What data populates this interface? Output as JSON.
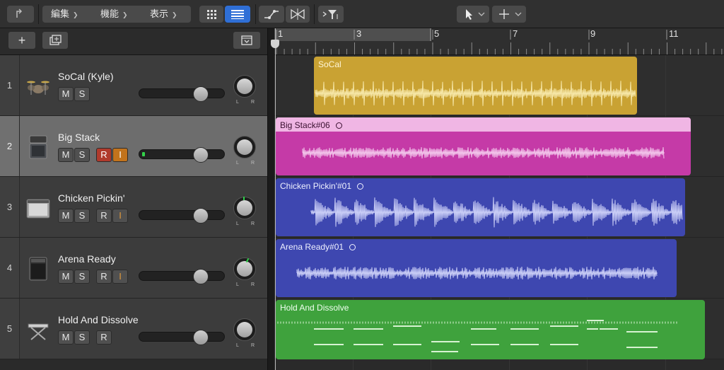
{
  "toolbar": {
    "back_icon": "catch-back-icon",
    "menus": [
      {
        "label": "編集"
      },
      {
        "label": "機能"
      },
      {
        "label": "表示"
      }
    ],
    "grid_view_icon": "grid-view-icon",
    "list_view_icon": "list-view-icon",
    "automation_icon": "automation-curve-icon",
    "flex_icon": "flex-time-icon",
    "catch_icon": "snap-filter-icon",
    "pointer_tool_icon": "pointer-tool-icon",
    "secondary_tool_icon": "crosshair-tool-icon",
    "accent": "#2f6fd6"
  },
  "header": {
    "add_track_icon": "plus-icon",
    "duplicate_track_icon": "duplicate-track-icon",
    "global_tracks_icon": "global-tracks-icon"
  },
  "ruler": {
    "bars": [
      "1",
      "3",
      "5",
      "7",
      "9",
      "11"
    ]
  },
  "tracks": [
    {
      "number": "1",
      "name": "SoCal (Kyle)",
      "icon": "drum-kit-icon",
      "mute": "M",
      "solo": "S",
      "record": "",
      "input": ""
    },
    {
      "number": "2",
      "name": "Big Stack",
      "icon": "amp-stack-icon",
      "mute": "M",
      "solo": "S",
      "record": "R",
      "input": "I"
    },
    {
      "number": "3",
      "name": "Chicken Pickin'",
      "icon": "combo-amp-icon",
      "mute": "M",
      "solo": "S",
      "record": "R",
      "input": "I"
    },
    {
      "number": "4",
      "name": "Arena Ready",
      "icon": "amp-head-icon",
      "mute": "M",
      "solo": "S",
      "record": "R",
      "input": "I"
    },
    {
      "number": "5",
      "name": "Hold And Dissolve",
      "icon": "keyboard-stand-icon",
      "mute": "M",
      "solo": "S",
      "record": "R",
      "input": ""
    }
  ],
  "pan_labels": {
    "left": "L",
    "right": "R"
  },
  "regions": [
    {
      "name": "SoCal",
      "color": "#c9a233",
      "wave": "#f6e7a8"
    },
    {
      "name": "Big Stack#06",
      "color": "#c53aa7",
      "header": "#f0b6e4",
      "wave": "#f2c4ea"
    },
    {
      "name": "Chicken Pickin'#01",
      "color": "#3e47b0",
      "wave": "#c9cdf6"
    },
    {
      "name": "Arena Ready#01",
      "color": "#3e47b0",
      "wave": "#c9cdf6"
    },
    {
      "name": "Hold And Dissolve",
      "color": "#3fa23d",
      "wave": "#d7f2d2"
    }
  ]
}
